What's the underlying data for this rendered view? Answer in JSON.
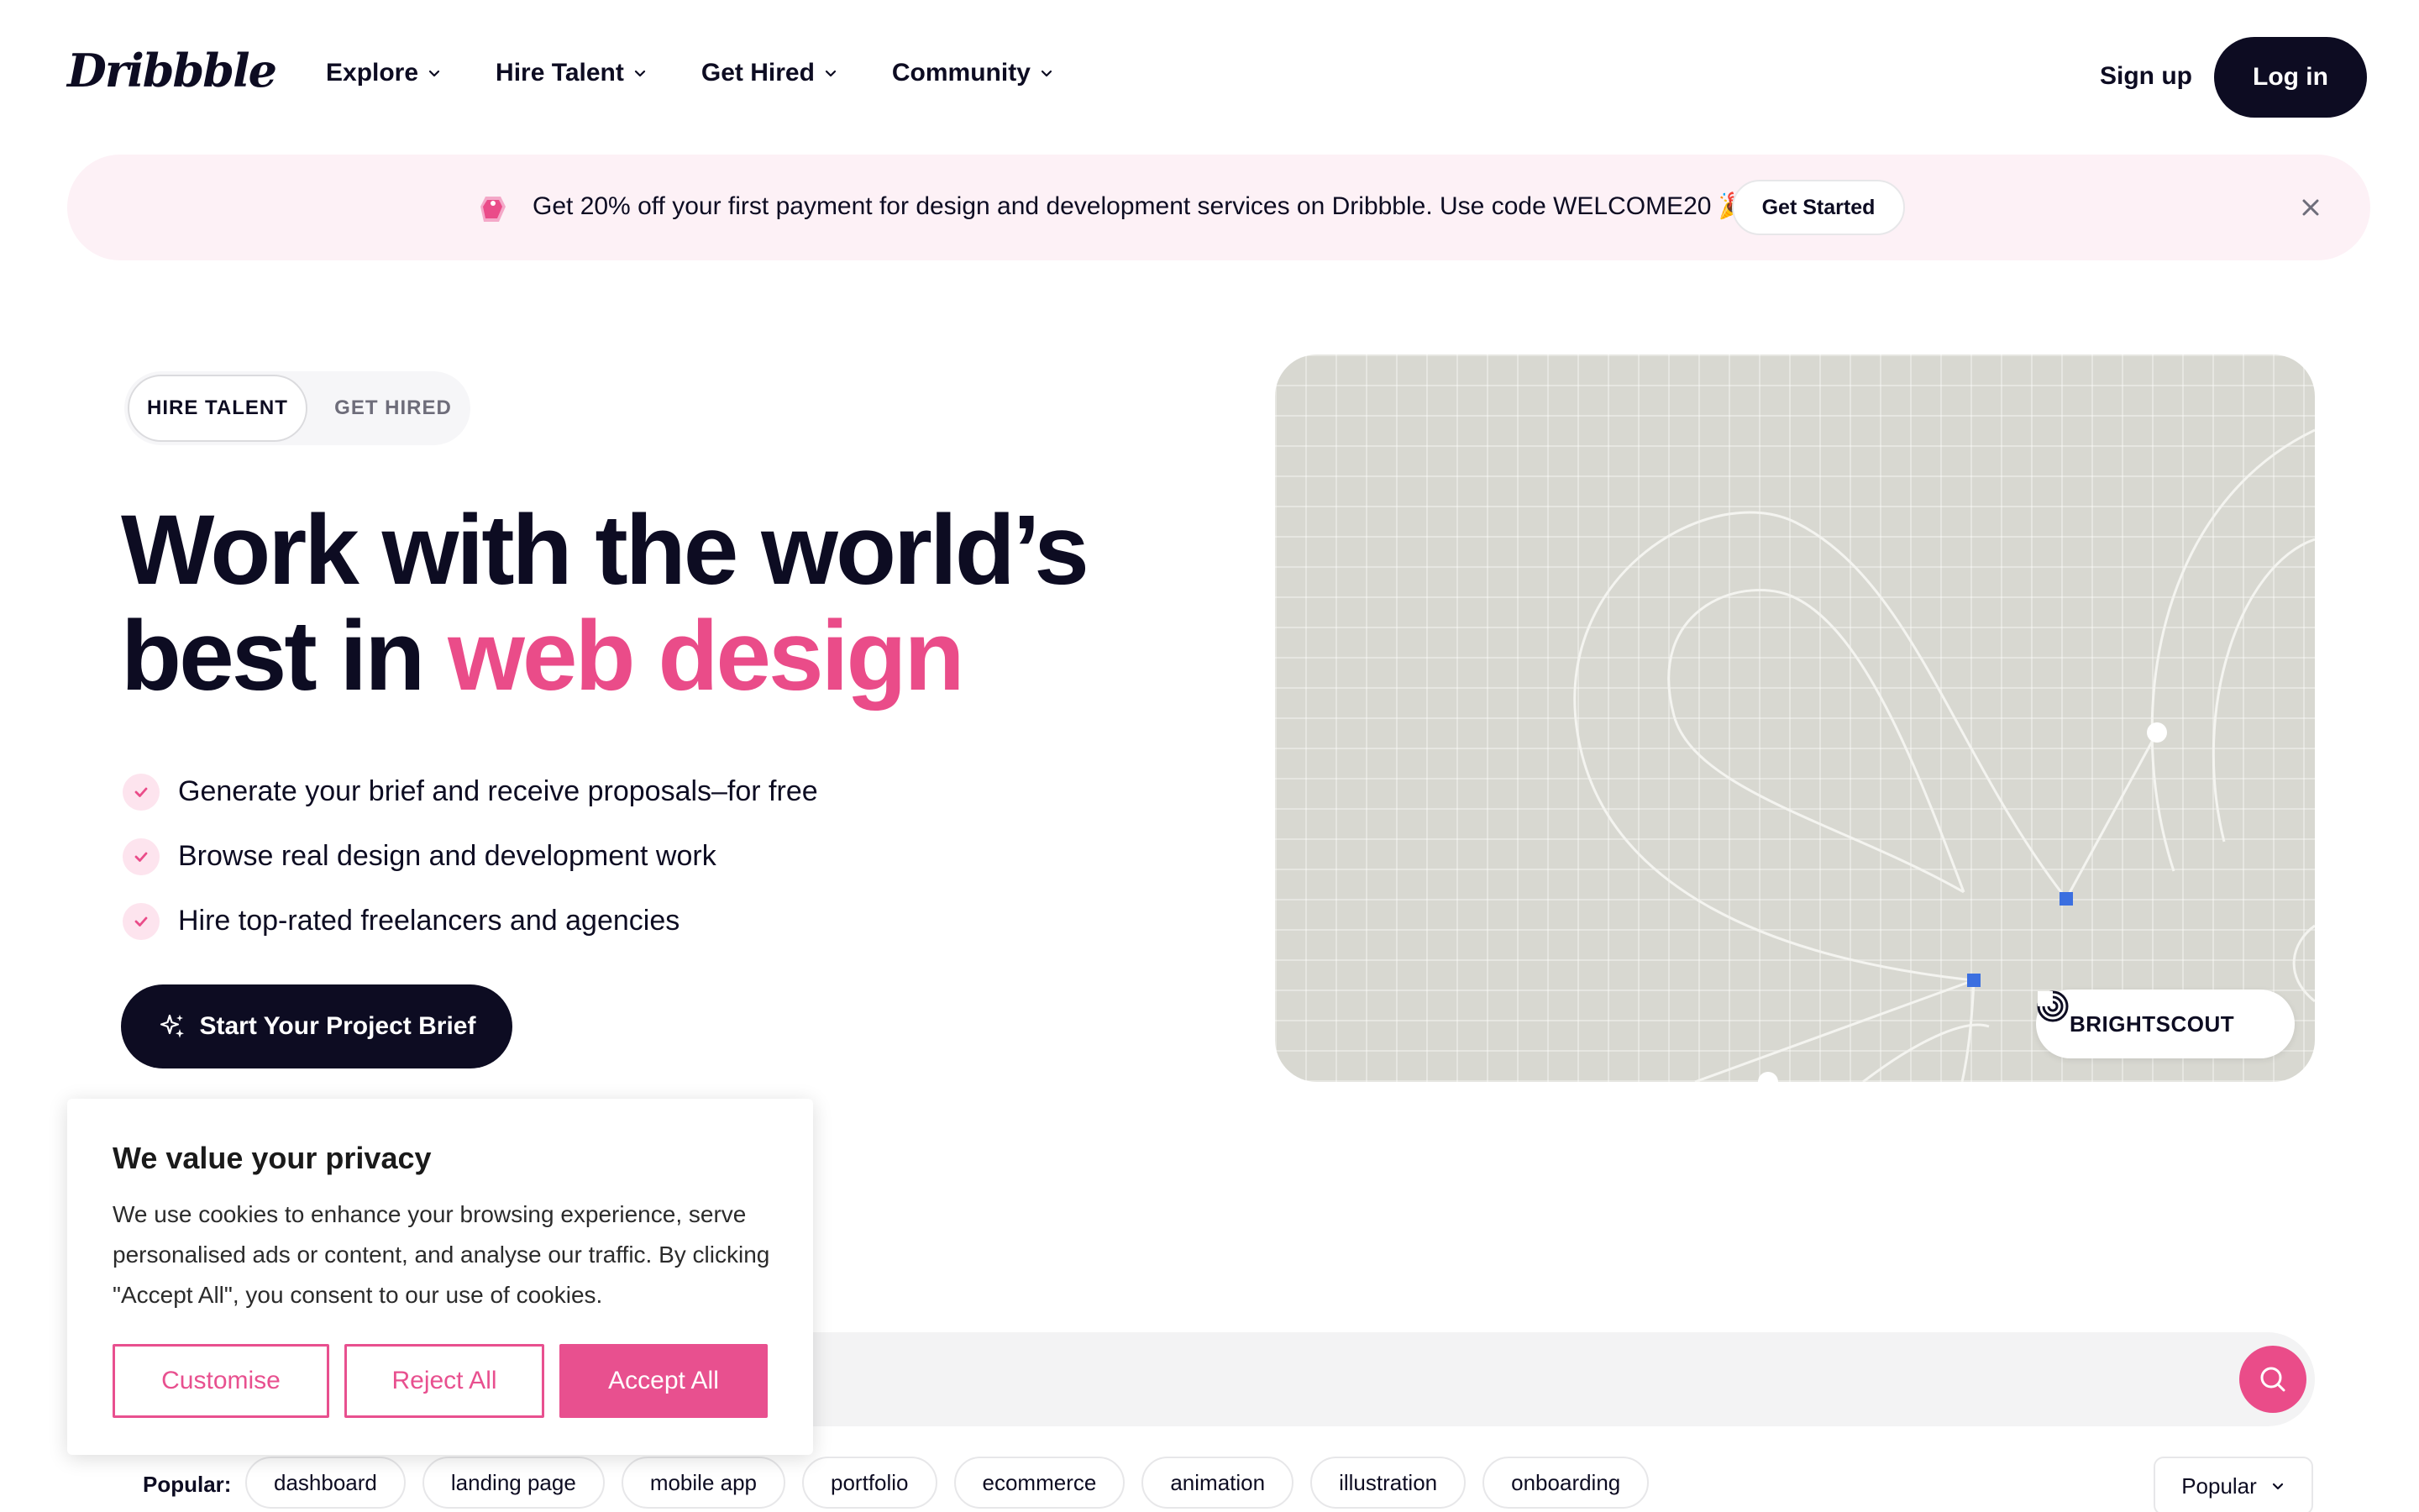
{
  "header": {
    "logo": "Dribbble",
    "nav": [
      {
        "label": "Explore"
      },
      {
        "label": "Hire Talent"
      },
      {
        "label": "Get Hired"
      },
      {
        "label": "Community"
      }
    ],
    "signup": "Sign up",
    "login": "Log in"
  },
  "promo": {
    "text": "Get 20% off your first payment for design and development services on Dribbble. Use code WELCOME20 🎉",
    "cta": "Get Started"
  },
  "toggle": {
    "active": "HIRE TALENT",
    "inactive": "GET HIRED"
  },
  "hero": {
    "title_line1": "Work with the world’s",
    "title_line2_prefix": "best in ",
    "title_accent": "web design",
    "bullets": [
      "Generate your brief and receive proposals–for free",
      "Browse real design and development work",
      "Hire top-rated freelancers and agencies"
    ],
    "cta": "Start Your Project Brief",
    "badge": "BRIGHTSCOUT"
  },
  "search": {
    "placeholder": ""
  },
  "popular": {
    "label": "Popular:",
    "tags": [
      "dashboard",
      "landing page",
      "mobile app",
      "portfolio",
      "ecommerce",
      "animation",
      "illustration",
      "onboarding"
    ],
    "sort": "Popular"
  },
  "cookie": {
    "title": "We value your privacy",
    "body": "We use cookies to enhance your browsing experience, serve personalised ads or content, and analyse our traffic. By clicking \"Accept All\", you consent to our use of cookies.",
    "customise": "Customise",
    "reject": "Reject All",
    "accept": "Accept All"
  },
  "colors": {
    "brand_pink": "#ea4c89",
    "ink": "#0d0c22",
    "promo_bg": "#fdf1f6"
  }
}
